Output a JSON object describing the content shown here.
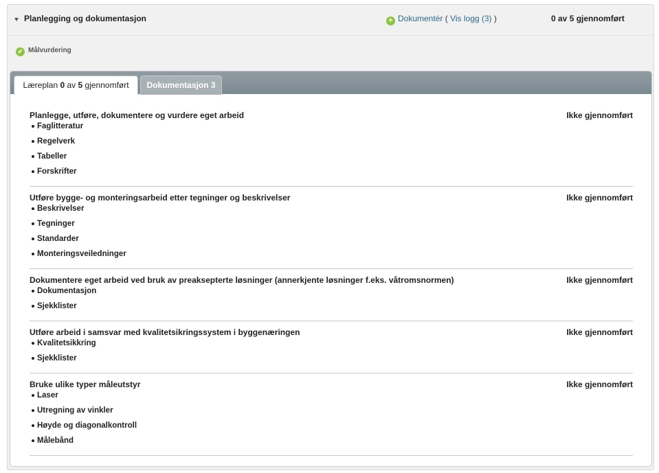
{
  "section": {
    "title": "Planlegging og dokumentasjon",
    "documenter_label": "Dokumentér",
    "paren_open": "(",
    "vis_logg_label": "Vis logg (3)",
    "paren_close": ")",
    "progress": "0 av 5 gjennomført"
  },
  "malvurdering": "Målvurdering",
  "tabs": {
    "active": {
      "prefix": "Læreplan ",
      "done": "0",
      "mid": " av ",
      "total": "5",
      "suffix": " gjennomført"
    },
    "inactive": {
      "label": "Dokumentasjon 3"
    }
  },
  "items": [
    {
      "title": "Planlegge, utføre, dokumentere og vurdere eget arbeid",
      "status": "Ikke gjennomført",
      "subs": [
        "Faglitteratur",
        "Regelverk",
        "Tabeller",
        "Forskrifter"
      ]
    },
    {
      "title": "Utføre bygge- og monteringsarbeid etter tegninger og beskrivelser",
      "status": "Ikke gjennomført",
      "subs": [
        "Beskrivelser",
        "Tegninger",
        "Standarder",
        "Monteringsveiledninger"
      ]
    },
    {
      "title": "Dokumentere eget arbeid ved bruk av preaksepterte løsninger (annerkjente løsninger f.eks. våtromsnormen)",
      "status": "Ikke gjennomført",
      "subs": [
        "Dokumentasjon",
        "Sjekklister"
      ]
    },
    {
      "title": "Utføre arbeid i samsvar med kvalitetsikringssystem i byggenæringen",
      "status": "Ikke gjennomført",
      "subs": [
        "Kvalitetsikkring",
        "Sjekklister"
      ]
    },
    {
      "title": "Bruke ulike typer måleutstyr",
      "status": "Ikke gjennomført",
      "subs": [
        "Laser",
        "Utregning av vinkler",
        "Høyde og diagonalkontroll",
        "Målebånd"
      ]
    }
  ]
}
